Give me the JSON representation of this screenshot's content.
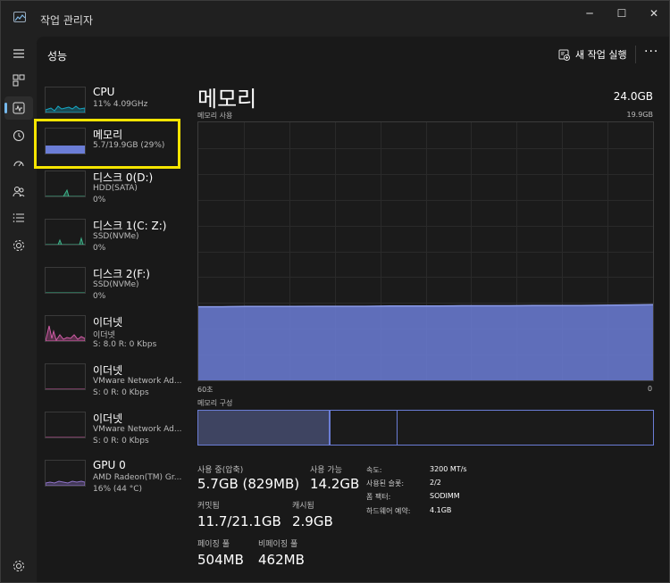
{
  "app": {
    "title": "작업 관리자"
  },
  "window_controls": {
    "minimize": "─",
    "maximize": "☐",
    "close": "✕"
  },
  "header": {
    "title": "성능",
    "new_task_label": "새 작업 실행",
    "more": "···"
  },
  "sidebar": {
    "items": [
      {
        "name": "CPU",
        "line1": "11%  4.09GHz",
        "line2": "",
        "color": "#17a7c3"
      },
      {
        "name": "메모리",
        "line1": "5.7/19.9GB (29%)",
        "line2": "",
        "color": "#6b7dd6",
        "selected": true
      },
      {
        "name": "디스크 0(D:)",
        "line1": "HDD(SATA)",
        "line2": "0%",
        "color": "#3db38a"
      },
      {
        "name": "디스크 1(C: Z:)",
        "line1": "SSD(NVMe)",
        "line2": "0%",
        "color": "#3db38a"
      },
      {
        "name": "디스크 2(F:)",
        "line1": "SSD(NVMe)",
        "line2": "0%",
        "color": "#3db38a"
      },
      {
        "name": "이더넷",
        "line1": "이더넷",
        "line2": "S: 8.0  R: 0 Kbps",
        "color": "#d05ca6"
      },
      {
        "name": "이더넷",
        "line1": "VMware Network Ad...",
        "line2": "S: 0  R: 0 Kbps",
        "color": "#d05ca6"
      },
      {
        "name": "이더넷",
        "line1": "VMware Network Ad...",
        "line2": "S: 0  R: 0 Kbps",
        "color": "#d05ca6"
      },
      {
        "name": "GPU 0",
        "line1": "AMD Radeon(TM) Gr...",
        "line2": "16% (44 °C)",
        "color": "#8f73c8"
      }
    ]
  },
  "main": {
    "title": "메모리",
    "total": "24.0GB",
    "usage_label": "메모리 사용",
    "usage_max": "19.9GB",
    "time_left": "60초",
    "time_right": "0",
    "composition_label": "메모리 구성",
    "composition": {
      "in_use_fraction": 0.29,
      "modified_fraction": 0.145
    },
    "stats": {
      "in_use_label": "사용 중(압축)",
      "in_use_value": "5.7GB (829MB)",
      "available_label": "사용 가능",
      "available_value": "14.2GB",
      "committed_label": "커밋됨",
      "committed_value": "11.7/21.1GB",
      "cached_label": "캐시됨",
      "cached_value": "2.9GB",
      "paged_label": "페이징 풀",
      "paged_value": "504MB",
      "nonpaged_label": "비페이징 풀",
      "nonpaged_value": "462MB"
    },
    "specs": [
      {
        "label": "속도:",
        "value": "3200 MT/s"
      },
      {
        "label": "사용된 슬롯:",
        "value": "2/2"
      },
      {
        "label": "폼 팩터:",
        "value": "SODIMM"
      },
      {
        "label": "하드웨어 예약:",
        "value": "4.1GB"
      }
    ],
    "graph_color": "#6b7dd6",
    "usage_series_fraction_of_max": [
      0.285,
      0.285,
      0.286,
      0.286,
      0.286,
      0.287,
      0.287,
      0.287,
      0.288,
      0.288,
      0.288,
      0.289,
      0.289,
      0.289,
      0.29,
      0.29,
      0.29,
      0.291,
      0.292,
      0.293
    ]
  }
}
